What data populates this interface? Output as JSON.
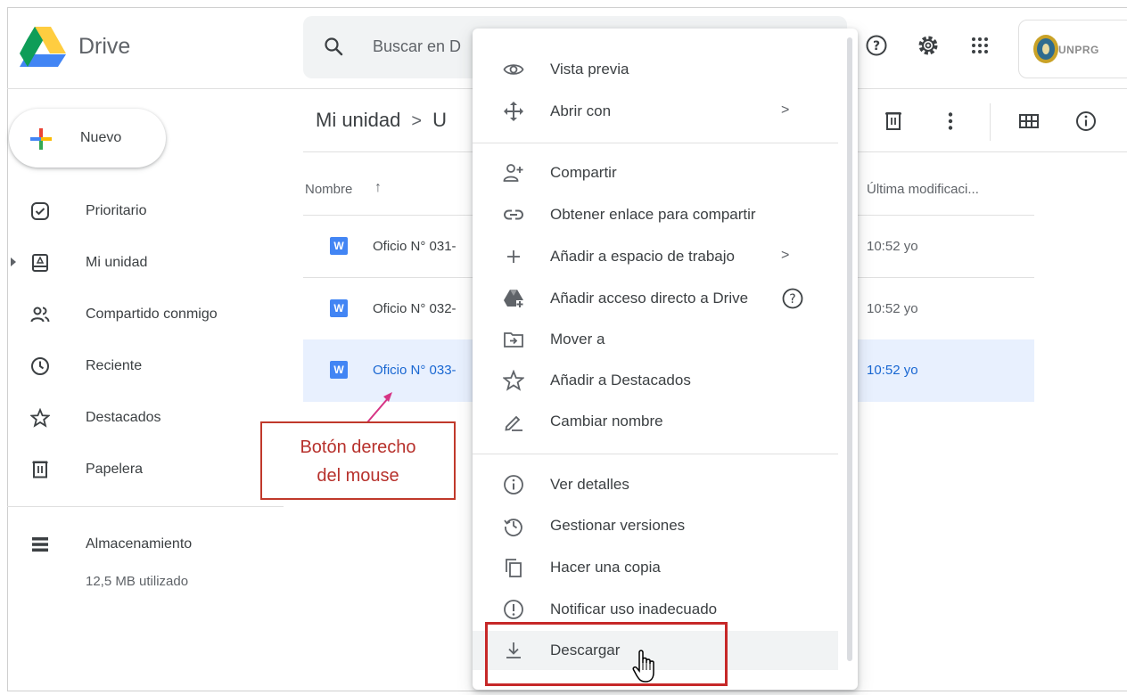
{
  "app": {
    "brand": "Drive",
    "account_badge": "UNPRG"
  },
  "search": {
    "placeholder": "Buscar en D"
  },
  "header_icons": [
    "help-icon",
    "settings-icon",
    "apps-grid-icon"
  ],
  "sidebar": {
    "new_label": "Nuevo",
    "items": [
      {
        "label": "Prioritario",
        "icon": "priority-check-icon"
      },
      {
        "label": "Mi unidad",
        "icon": "my-drive-icon"
      },
      {
        "label": "Compartido conmigo",
        "icon": "shared-people-icon"
      },
      {
        "label": "Reciente",
        "icon": "clock-icon"
      },
      {
        "label": "Destacados",
        "icon": "star-icon"
      },
      {
        "label": "Papelera",
        "icon": "trash-icon"
      }
    ],
    "storage": {
      "label": "Almacenamiento",
      "used": "12,5 MB utilizado"
    }
  },
  "breadcrumb": {
    "root": "Mi unidad",
    "separator": ">",
    "current": "U"
  },
  "table": {
    "col_name": "Nombre",
    "sort_arrow": "↑",
    "col_modified": "Última modificaci...",
    "rows": [
      {
        "type": "W",
        "name": "Oficio N° 031-",
        "modified": "10:52 yo",
        "selected": false
      },
      {
        "type": "W",
        "name": "Oficio N° 032-",
        "modified": "10:52 yo",
        "selected": false
      },
      {
        "type": "W",
        "name": "Oficio N° 033-",
        "modified": "10:52 yo",
        "selected": true
      }
    ]
  },
  "annotation": {
    "line1": "Botón derecho",
    "line2": "del mouse",
    "color": "#c0392b"
  },
  "context_menu": {
    "items": [
      {
        "label": "Vista previa",
        "icon": "eye-icon"
      },
      {
        "label": "Abrir con",
        "icon": "open-with-icon",
        "chevron": ">"
      },
      {
        "label": "Compartir",
        "icon": "person-add-icon"
      },
      {
        "label": "Obtener enlace para compartir",
        "icon": "link-icon"
      },
      {
        "label": "Añadir a espacio de trabajo",
        "icon": "plus-icon",
        "chevron": ">"
      },
      {
        "label": "Añadir acceso directo a Drive",
        "icon": "drive-shortcut-icon",
        "help": "?"
      },
      {
        "label": "Mover a",
        "icon": "move-folder-icon"
      },
      {
        "label": "Añadir a Destacados",
        "icon": "star-icon"
      },
      {
        "label": "Cambiar nombre",
        "icon": "pencil-icon"
      },
      {
        "label": "Ver detalles",
        "icon": "info-icon"
      },
      {
        "label": "Gestionar versiones",
        "icon": "history-icon"
      },
      {
        "label": "Hacer una copia",
        "icon": "copy-icon"
      },
      {
        "label": "Notificar uso inadecuado",
        "icon": "report-icon"
      },
      {
        "label": "Descargar",
        "icon": "download-icon"
      }
    ]
  },
  "colors": {
    "selected_row": "#e8f0fe",
    "selected_text": "#1967d2",
    "highlight_border": "#c62828"
  }
}
